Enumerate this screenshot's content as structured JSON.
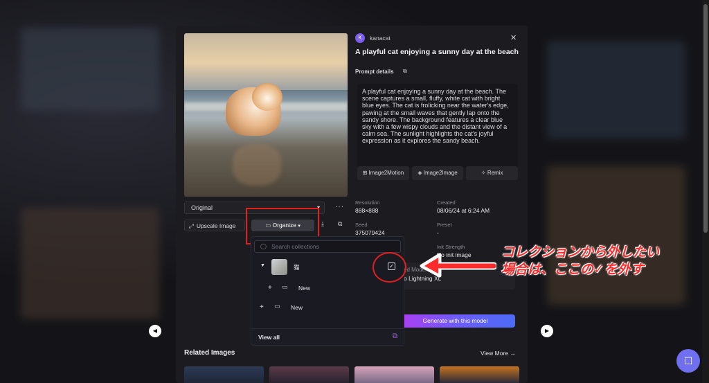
{
  "image_card": {
    "size_select": "Original",
    "more_label": "···",
    "upscale_label": "Upscale Image",
    "organize_label": "Organize",
    "download_icon": "download-icon",
    "open_icon": "external-link-icon"
  },
  "info": {
    "avatar_letter": "K",
    "username": "kanacat",
    "close_label": "✕",
    "title": "A playful cat enjoying a sunny day at the beach",
    "prompt_details_label": "Prompt details",
    "prompt_text": "A playful cat enjoying a sunny day at the beach. The scene captures a small, fluffy, white cat with bright blue eyes. The cat is frolicking near the water's edge, pawing at the small waves that gently lap onto the sandy shore. The background features a clear blue sky with a few wispy clouds and the distant view of a calm sea. The sunlight highlights the cat's joyful expression as it explores the sandy beach.",
    "chips": [
      "Image2Motion",
      "Image2Image",
      "Remix"
    ],
    "resolution_label": "Resolution",
    "resolution_value": "888×888",
    "created_label": "Created",
    "created_value": "08/06/24 at 6:24 AM",
    "seed_label": "Seed",
    "seed_value": "375079424",
    "preset_label": "Preset",
    "preset_value": "-",
    "init_label": "Init Strength",
    "init_value": "No init image",
    "model_label": "ed Model",
    "model_value": "o Lightning XL",
    "generate_label": "Generate with this model"
  },
  "related": {
    "title": "Related Images",
    "view_more": "View More"
  },
  "collections_dropdown": {
    "search_placeholder": "Search collections",
    "collection_name": "猫",
    "new_sub_label": "New",
    "new_label": "New",
    "view_all": "View all"
  },
  "annotation": {
    "line1": "コレクションから外したい",
    "line2": "場合は、ここの✓を外す"
  },
  "colors": {
    "accent_purple": "#7a5cf0",
    "highlight_red": "#e11f1f",
    "gradient_start": "#b13cf1",
    "gradient_end": "#4c6bf6"
  }
}
